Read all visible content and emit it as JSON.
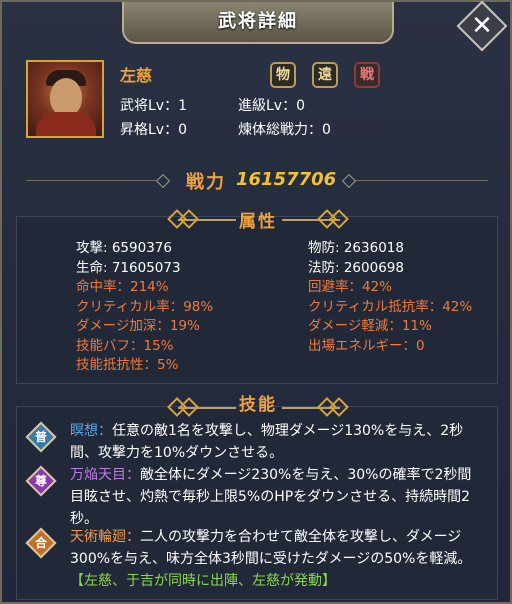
{
  "window": {
    "title": "武将詳細",
    "close_glyph": "✕"
  },
  "general": {
    "name": "左慈",
    "portrait_icon": "general-portrait",
    "badges": [
      {
        "label": "物",
        "icon": "physical-badge-icon"
      },
      {
        "label": "遠",
        "icon": "ranged-badge-icon"
      },
      {
        "label": "戦",
        "icon": "warrior-badge-icon"
      }
    ],
    "stats": {
      "general_lv": "武将Lv：1",
      "promotion_lv": "昇格Lv：0",
      "advance_lv": "進級Lv：0",
      "refine_power": "煉体総戦力：0"
    }
  },
  "power": {
    "label": "戦力",
    "value": "16157706"
  },
  "attributes": {
    "title": "属性",
    "left": [
      {
        "text": "攻撃: 6590376",
        "color": "white"
      },
      {
        "text": "生命: 71605073",
        "color": "white"
      },
      {
        "text": "命中率：214%",
        "color": "orange"
      },
      {
        "text": "クリティカル率：98%",
        "color": "orange"
      },
      {
        "text": "ダメージ加深：19%",
        "color": "orange"
      },
      {
        "text": "技能バフ：15%",
        "color": "orange"
      },
      {
        "text": "技能抵抗性：5%",
        "color": "orange"
      }
    ],
    "right": [
      {
        "text": "物防: 2636018",
        "color": "white"
      },
      {
        "text": "法防: 2600698",
        "color": "white"
      },
      {
        "text": "回避率：42%",
        "color": "orange"
      },
      {
        "text": "クリティカル抵抗率：42%",
        "color": "orange"
      },
      {
        "text": "ダメージ軽減：11%",
        "color": "orange"
      },
      {
        "text": "出場エネルギー：0",
        "color": "orange"
      }
    ]
  },
  "skills": {
    "title": "技能",
    "items": [
      {
        "icon_label": "普",
        "icon_name": "normal-skill-icon",
        "icon_color": "#3a7aa8",
        "name": "瞑想：",
        "name_color": "#5aa8e8",
        "desc": "任意の敵1名を攻撃し、物理ダメージ130%を与え、2秒間、攻撃力を10%ダウンさせる。"
      },
      {
        "icon_label": "尊",
        "icon_name": "ultimate-skill-icon",
        "icon_color": "#8a3aa8",
        "name": "万焔天目：",
        "name_color": "#c07ae8",
        "desc": "敵全体にダメージ230%を与え、30%の確率で2秒間目眩させ、灼熱で毎秒上限5%のHPをダウンさせる、持続時間2秒。"
      },
      {
        "icon_label": "合",
        "icon_name": "combo-skill-icon",
        "icon_color": "#c0702a",
        "name": "天術輪廻：",
        "name_color": "#f09a4a",
        "desc": "二人の攻撃力を合わせて敵全体を攻撃し、ダメージ300%を与え、味方全体3秒間に受けたダメージの50%を軽減。",
        "condition": "【左慈、于吉が同時に出陣、左慈が発動】",
        "condition_color": "#8ad84a"
      }
    ]
  }
}
